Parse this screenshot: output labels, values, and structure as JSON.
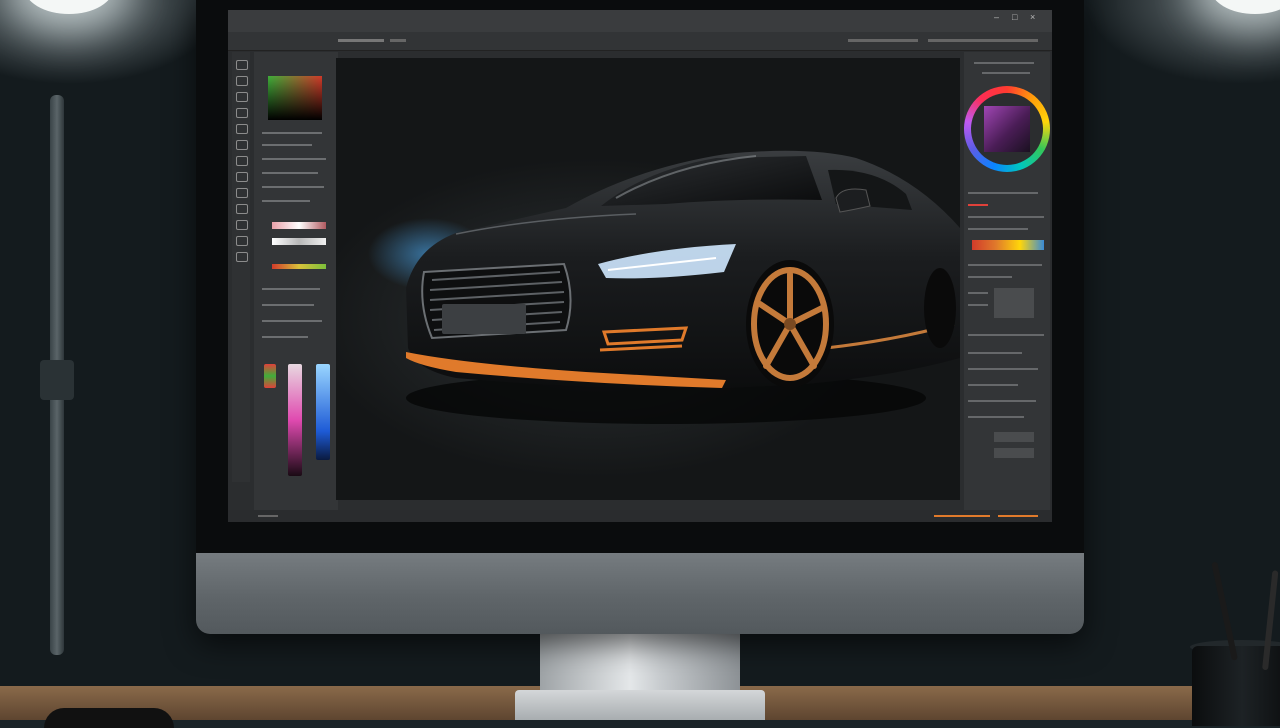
{
  "scene": {
    "description_free": true
  },
  "app": {
    "menu": [
      "",
      ""
    ],
    "status_right": ""
  },
  "colors": {
    "accent_orange": "#e07a2b",
    "car_body": "#1a1c1d",
    "wheel_gold": "#c47a3a",
    "headlight": "#dff3ff"
  },
  "icons": {
    "tools": [
      "move-tool-icon",
      "marquee-tool-icon",
      "lasso-tool-icon",
      "crop-tool-icon",
      "eyedropper-tool-icon",
      "brush-tool-icon",
      "stamp-tool-icon",
      "eraser-tool-icon",
      "gradient-tool-icon",
      "pen-tool-icon",
      "text-tool-icon",
      "hand-tool-icon",
      "zoom-tool-icon"
    ],
    "window_controls": [
      "minimize-icon",
      "maximize-icon",
      "close-icon"
    ]
  }
}
